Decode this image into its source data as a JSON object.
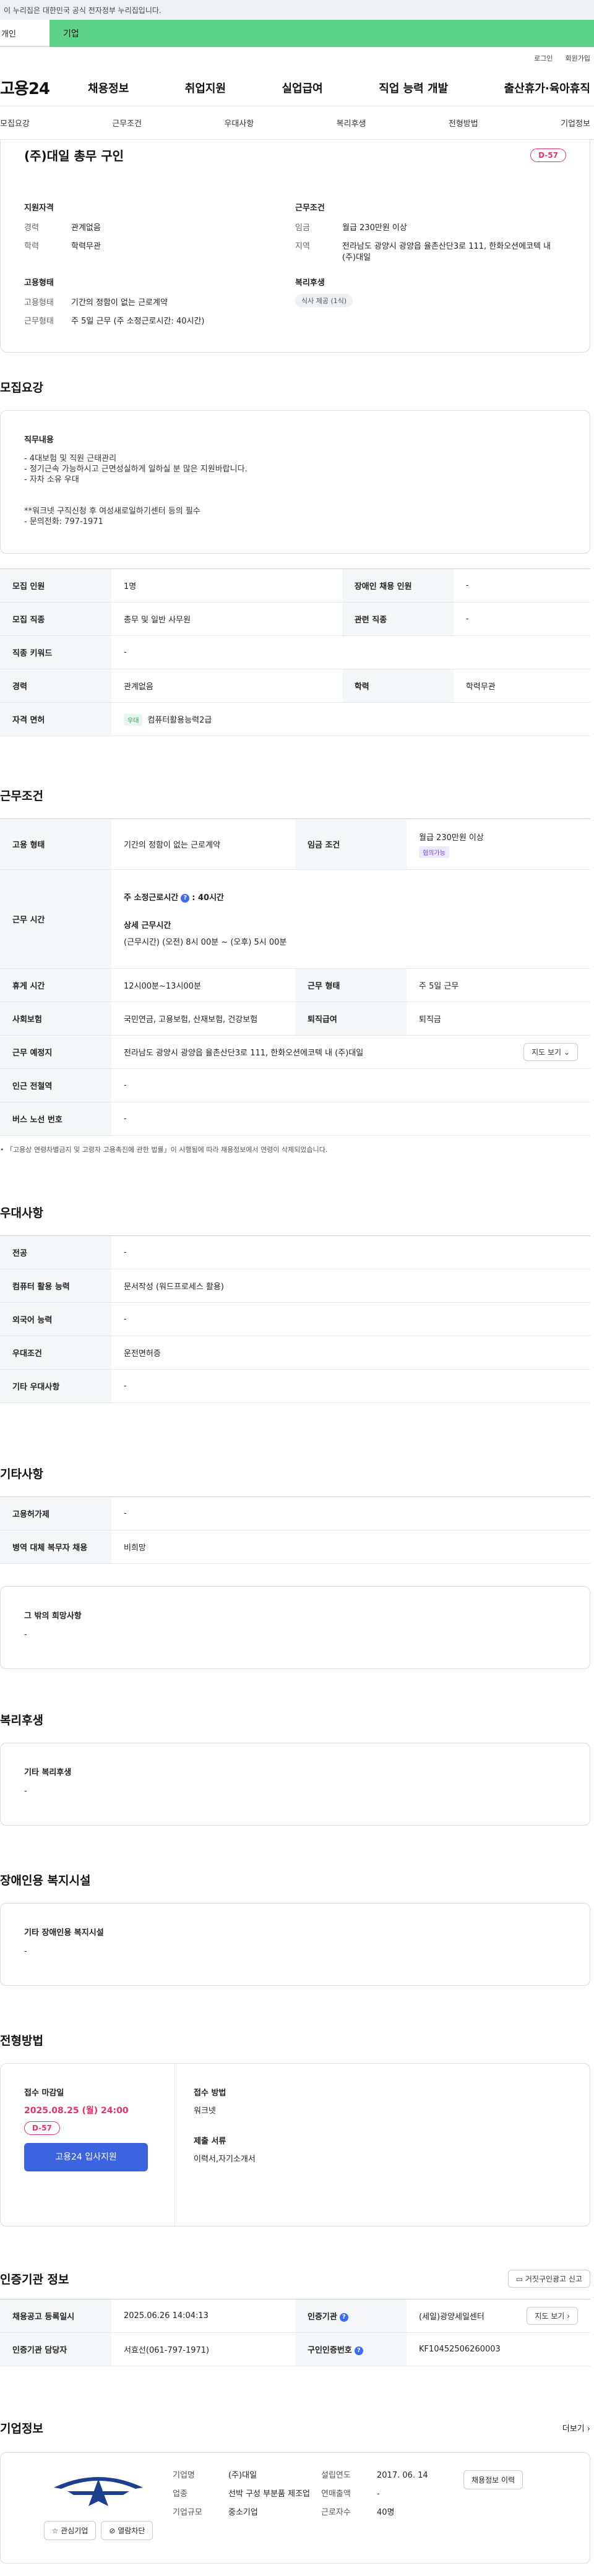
{
  "gov_banner": "이 누리집은 대한민국 공식 전자정부 누리집입니다.",
  "top_tabs": {
    "personal": "개인",
    "company": "기업"
  },
  "util": {
    "login": "로그인",
    "join": "회원가입"
  },
  "logo": "고용24",
  "gnb": [
    "채용정보",
    "취업지원",
    "실업급여",
    "직업 능력 개발",
    "출산휴가·육아휴직"
  ],
  "subnav": [
    "모집요강",
    "근무조건",
    "우대사항",
    "복리후생",
    "전형방법",
    "기업정보"
  ],
  "job": {
    "title": "(주)대일 총무 구인",
    "dday": "D-57",
    "qual_title": "지원자격",
    "career_label": "경력",
    "career": "관계없음",
    "edu_label": "학력",
    "edu": "학력무관",
    "work_title": "근무조건",
    "wage_label": "임금",
    "wage": "월급 230만원 이상",
    "region_label": "지역",
    "region": "전라남도 광양시 광양읍 율촌산단3로 111, 한화오션에코텍 내 (주)대일",
    "emp_title": "고용형태",
    "emp1_label": "고용형태",
    "emp1": "기간의 정함이 없는 근로계약",
    "emp2_label": "근무형태",
    "emp2": "주 5일 근무 (주 소정근로시간: 40시간)",
    "welfare_title": "복리후생",
    "welfare_chip": "식사 제공 (1식)"
  },
  "recruit": {
    "section": "모집요강",
    "duty_title": "직무내용",
    "duty_lines": [
      "- 4대보험 및 직원 근태관리",
      "- 정기근속 가능하시고 근면성실하게 일하실 분 많은 지원바랍니다.",
      "- 자차 소유 우대",
      "",
      "",
      "**워크넷 구직신청 후 여성새로일하기센터 등의 필수",
      "- 문의전화: 797-1971"
    ],
    "rows": {
      "count_label": "모집 인원",
      "count": "1명",
      "disabled_label": "장애인 채용 인원",
      "disabled": "-",
      "job_label": "모집 직종",
      "job": "총무 및 일반 사무원",
      "related_label": "관련 직종",
      "related": "-",
      "keyword_label": "직종 키워드",
      "keyword": "-",
      "career_label": "경력",
      "career": "관계없음",
      "edu_label": "학력",
      "edu": "학력무관",
      "license_label": "자격 면허",
      "license_badge": "우대",
      "license": "컴퓨터활용능력2급"
    }
  },
  "condition": {
    "section": "근무조건",
    "emp_label": "고용 형태",
    "emp": "기간의 정함이 없는 근로계약",
    "wage_label": "임금 조건",
    "wage": "월급 230만원 이상",
    "wage_badge": "협의가능",
    "time_label": "근무 시간",
    "weekly_hours_label": "주 소정근로시간",
    "weekly_hours": ": 40시간",
    "detail_title": "상세 근무시간",
    "detail": "(근무시간) (오전) 8시 00분 ~ (오후) 5시 00분",
    "break_label": "휴게 시간",
    "break": "12시00분~13시00분",
    "worktype_label": "근무 형태",
    "worktype": "주 5일 근무",
    "insurance_label": "사회보험",
    "insurance": "국민연금, 고용보험, 산재보험, 건강보험",
    "retire_label": "퇴직급여",
    "retire": "퇴직금",
    "place_label": "근무 예정지",
    "place": "전라남도 광양시 광양읍 율촌산단3로 111, 한화오션에코텍 내 (주)대일",
    "map_button": "지도 보기",
    "station_label": "인근 전철역",
    "station": "-",
    "bus_label": "버스 노선 번호",
    "bus": "-",
    "note": "「고용상 연령차별금지 및 고령자 고용촉진에 관한 법률」이 시행됨에 따라 채용정보에서 연령이 삭제되었습니다."
  },
  "pref": {
    "section": "우대사항",
    "major_label": "전공",
    "major": "-",
    "computer_label": "컴퓨터 활용 능력",
    "computer": "문서작성 (워드프로세스 활용)",
    "lang_label": "외국어 능력",
    "lang": "-",
    "cond_label": "우대조건",
    "cond": "운전면허증",
    "etc_label": "기타 우대사항",
    "etc": "-"
  },
  "other": {
    "section": "기타사항",
    "insurance_label": "고용허가제",
    "insurance": "-",
    "military_label": "병역 대체 복무자 채용",
    "military": "비희망",
    "wish_title": "그 밖의 희망사항",
    "wish": "-"
  },
  "welfare": {
    "section": "복리후생",
    "title": "기타 복리후생",
    "value": "-"
  },
  "facility": {
    "section": "장애인용 복지시설",
    "title": "기타 장애인용 복지시설",
    "value": "-"
  },
  "process": {
    "section": "전형방법",
    "deadline_title": "접수 마감일",
    "deadline": "2025.08.25 (월) 24:00",
    "dday": "D-57",
    "apply_button": "고용24 입사지원",
    "method_title": "접수 방법",
    "method": "워크넷",
    "docs_title": "제출 서류",
    "docs": "이력서,자기소개서"
  },
  "auth": {
    "section": "인증기관 정보",
    "report_button": "거짓구인광고 신고",
    "reg_date_label": "채용공고 등록일시",
    "reg_date": "2025.06.26 14:04:13",
    "agency_label": "인증기관",
    "agency": "(세일)광양세일센터",
    "map_button": "지도 보기",
    "manager_label": "인증기관 담당자",
    "manager": "서효선(061-797-1971)",
    "id_label": "구인인증번호",
    "id": "KF10452506260003"
  },
  "company": {
    "section": "기업정보",
    "more": "더보기",
    "interest_button": "관심기업",
    "block_button": "열람차단",
    "name_label": "기업명",
    "name": "(주)대일",
    "industry_label": "업종",
    "industry": "선박 구성 부분품 제조업",
    "size_label": "기업규모",
    "size": "중소기업",
    "founded_label": "설립연도",
    "founded": "2017. 06. 14",
    "sales_label": "연매출액",
    "sales": "-",
    "employees_label": "근로자수",
    "employees": "40명",
    "history_button": "채용정보 이력"
  }
}
